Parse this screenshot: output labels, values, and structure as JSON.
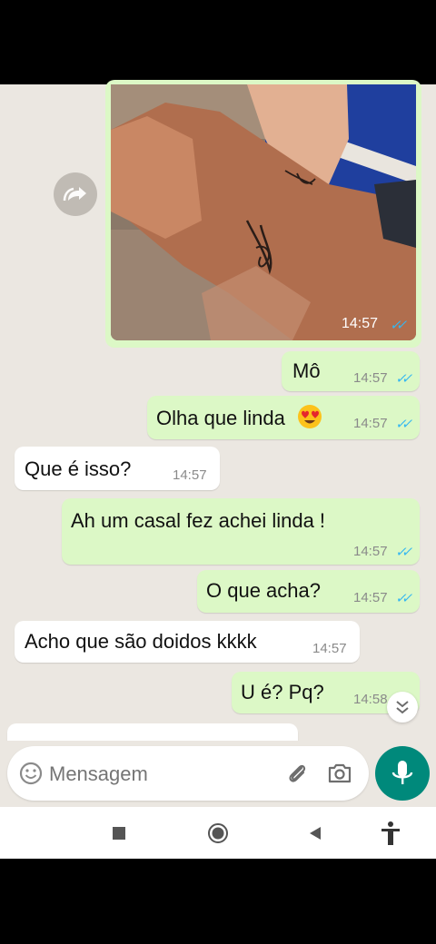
{
  "messages": [
    {
      "text": "Mô",
      "time": "14:57",
      "dir": "out"
    },
    {
      "text": "Olha que linda",
      "time": "14:57",
      "dir": "out"
    },
    {
      "text": "Que é isso?",
      "time": "14:57",
      "dir": "in"
    },
    {
      "text": "Ah um casal fez achei linda !",
      "time": "14:57",
      "dir": "out"
    },
    {
      "text": "O que acha?",
      "time": "14:57",
      "dir": "out"
    },
    {
      "text": "Acho que são doidos kkkk",
      "time": "14:57",
      "dir": "in"
    },
    {
      "text": "U é? Pq?",
      "time": "14:58",
      "dir": "out"
    }
  ],
  "image_message": {
    "time": "14:57"
  },
  "input": {
    "placeholder": "Mensagem"
  },
  "colors": {
    "outgoing_bubble": "#dcf8c6",
    "incoming_bubble": "#ffffff",
    "chat_background": "#ebe7e1",
    "read_ticks": "#34b7f1",
    "mic_button": "#00897b"
  },
  "icons": [
    "forward-icon",
    "emoji-icon",
    "attach-icon",
    "camera-icon",
    "mic-icon",
    "scroll-down-icon",
    "nav-square-icon",
    "nav-home-icon",
    "nav-back-icon",
    "accessibility-icon",
    "heart-eyes-emoji-icon"
  ]
}
